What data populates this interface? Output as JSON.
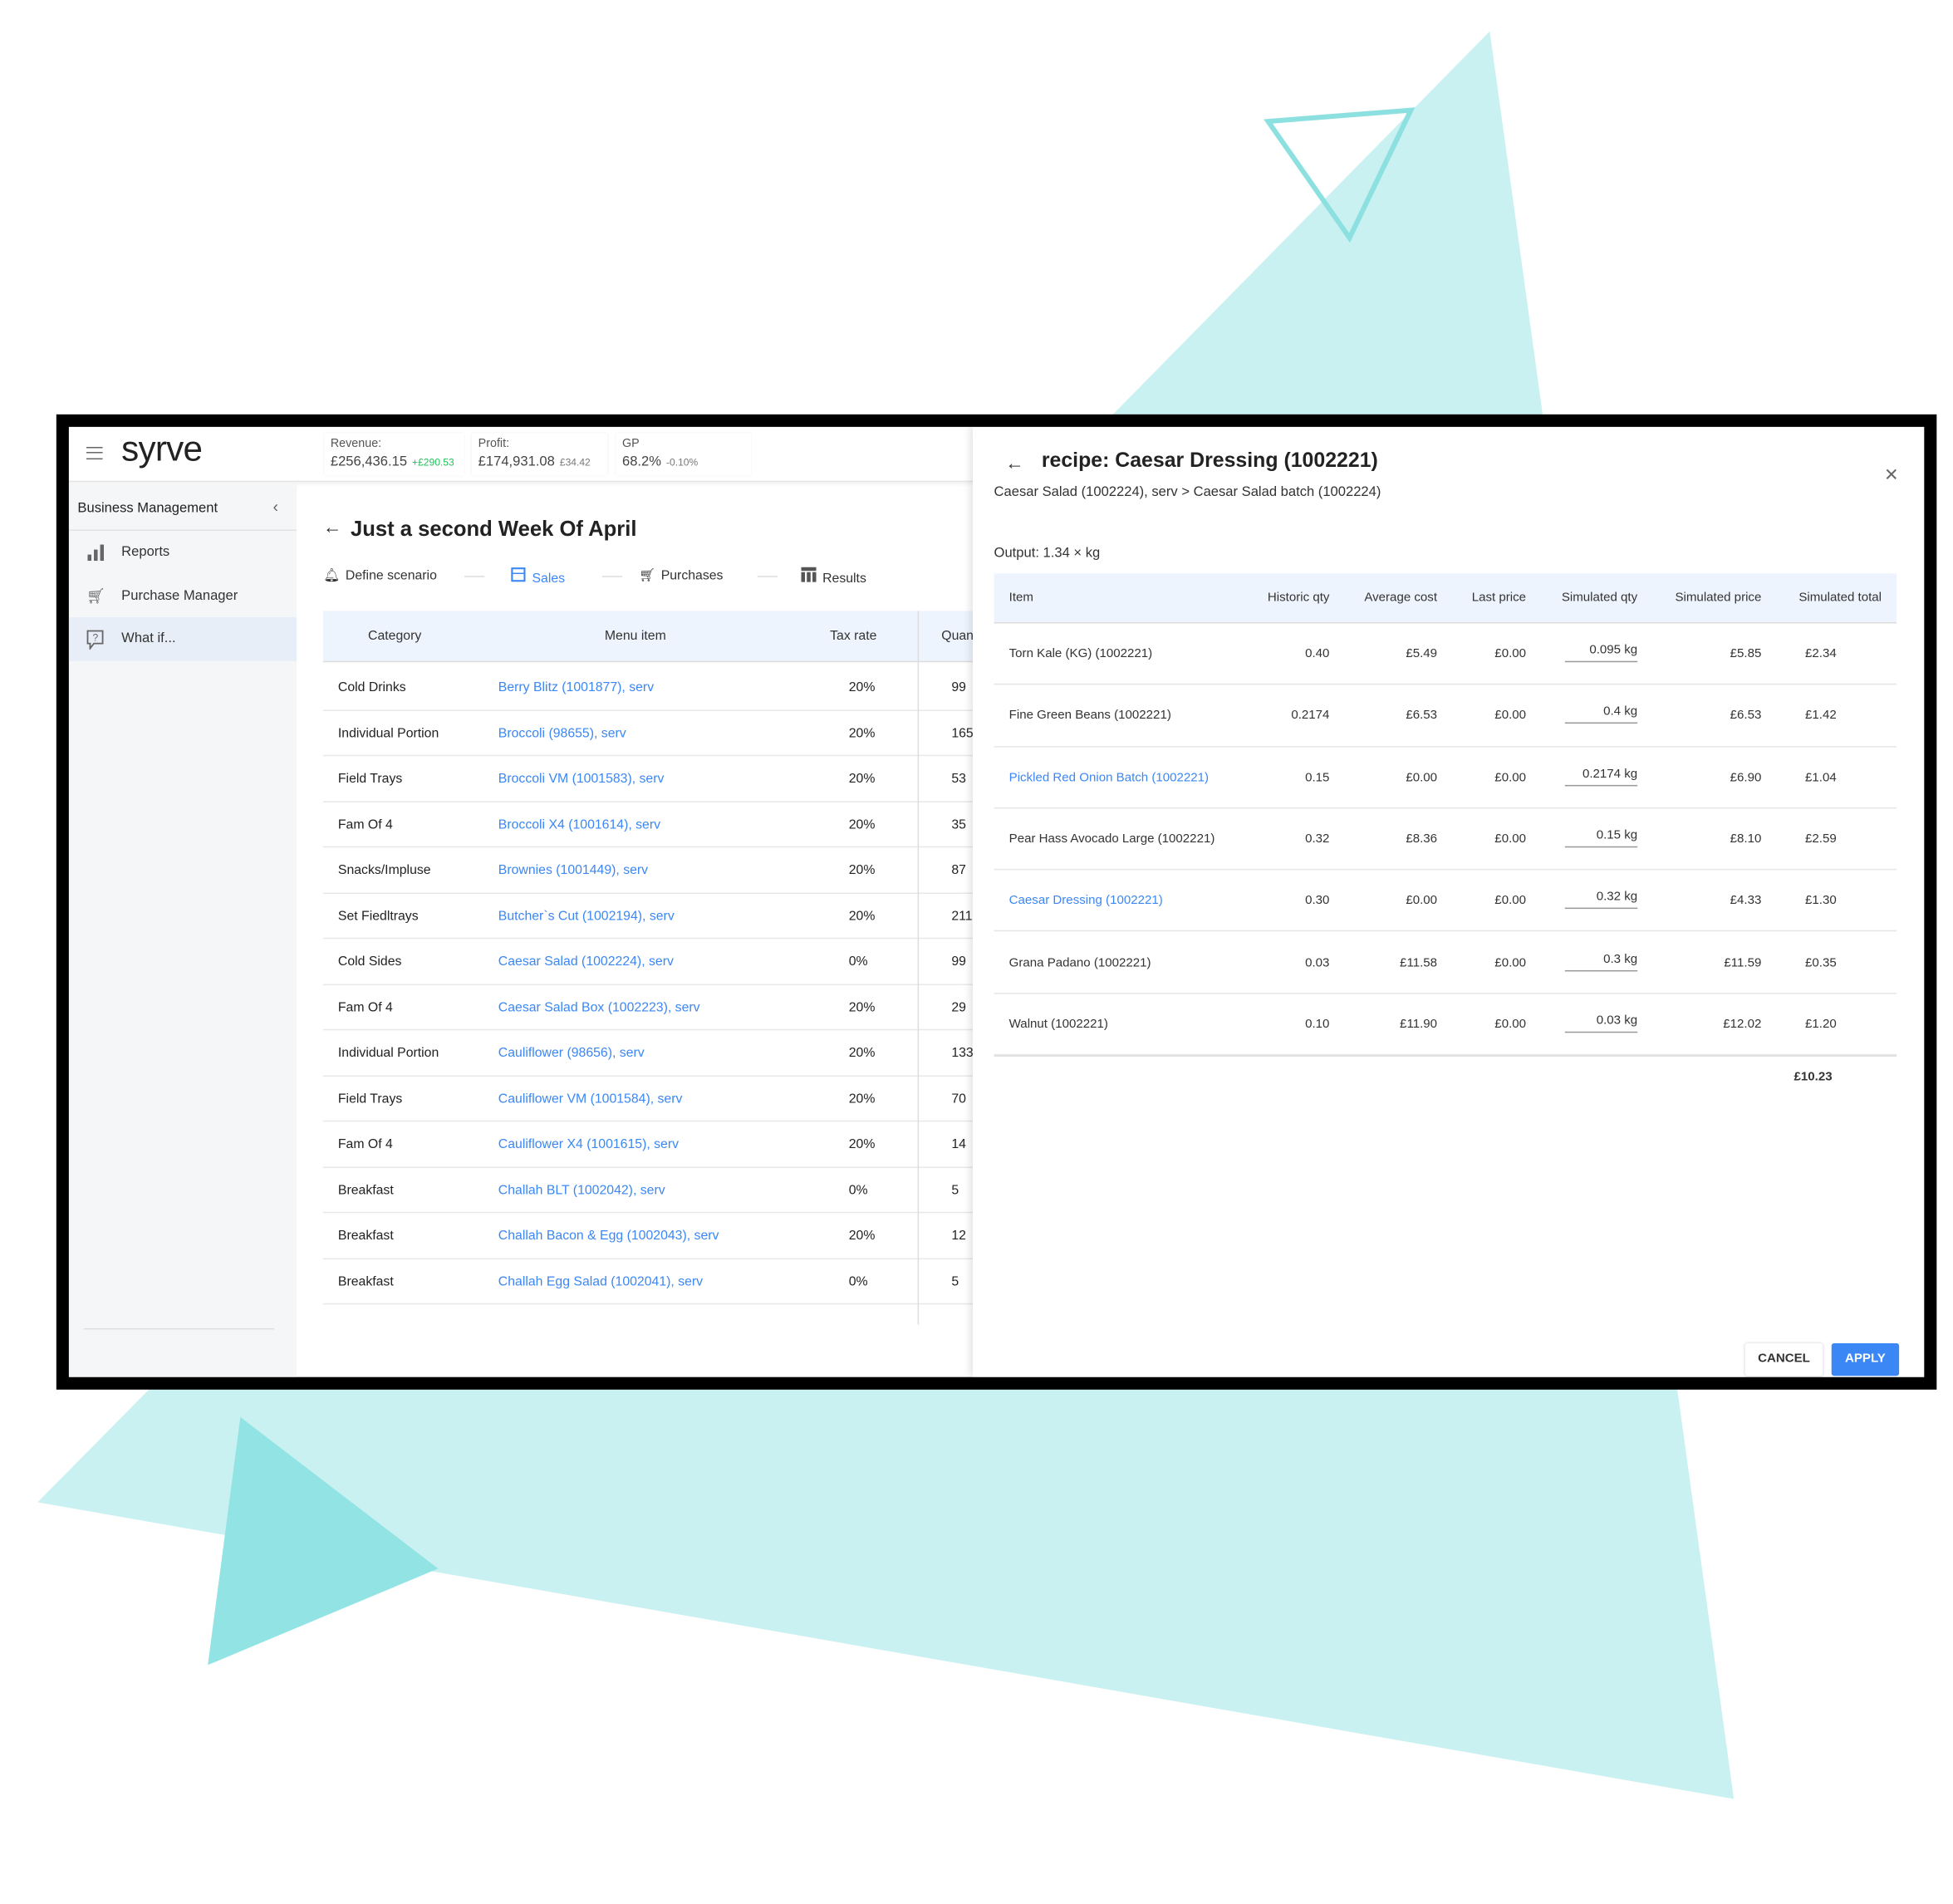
{
  "colors": {
    "accent": "#3b87f5",
    "positive": "#1fbf5a",
    "decor_light": "#c9f1f1",
    "decor_dark": "#92e3e3"
  },
  "header": {
    "logo": "syrve",
    "kpis": [
      {
        "label": "Revenue:",
        "value": "£256,436.15",
        "delta": "+£290.53"
      },
      {
        "label": "Profit:",
        "value": "£174,931.08",
        "delta": "£34.42"
      },
      {
        "label": "GP",
        "value": "68.2%",
        "delta": "-0.10%"
      }
    ]
  },
  "sidebar": {
    "section": "Business Management",
    "items": [
      {
        "label": "Reports",
        "icon": "bar-chart-icon"
      },
      {
        "label": "Purchase Manager",
        "icon": "cart-icon"
      },
      {
        "label": "What if...",
        "icon": "question-bubble-icon",
        "active": true
      }
    ]
  },
  "main": {
    "title": "Just a second Week Of April",
    "steps": [
      {
        "label": "Define scenario",
        "icon": "bell-icon"
      },
      {
        "label": "Sales",
        "icon": "store-icon",
        "active": true
      },
      {
        "label": "Purchases",
        "icon": "cart-icon"
      },
      {
        "label": "Results",
        "icon": "columns-icon"
      }
    ],
    "table": {
      "columns": [
        "Category",
        "Menu item",
        "Tax rate",
        "Quan"
      ],
      "rows": [
        [
          "Cold Drinks",
          "Berry Blitz (1001877), serv",
          "20%",
          "99"
        ],
        [
          "Individual Portion",
          "Broccoli (98655), serv",
          "20%",
          "165"
        ],
        [
          "Field Trays",
          "Broccoli VM (1001583), serv",
          "20%",
          "53"
        ],
        [
          "Fam Of 4",
          "Broccoli X4 (1001614), serv",
          "20%",
          "35"
        ],
        [
          "Snacks/Impluse",
          "Brownies (1001449), serv",
          "20%",
          "87"
        ],
        [
          "Set Fiedltrays",
          "Butcher`s Cut (1002194), serv",
          "20%",
          "211"
        ],
        [
          "Cold Sides",
          "Caesar Salad (1002224), serv",
          "0%",
          "99"
        ],
        [
          "Fam Of 4",
          "Caesar Salad Box (1002223), serv",
          "20%",
          "29"
        ],
        [
          "Individual Portion",
          "Cauliflower (98656), serv",
          "20%",
          "133"
        ],
        [
          "Field Trays",
          "Cauliflower VM (1001584), serv",
          "20%",
          "70"
        ],
        [
          "Fam Of 4",
          "Cauliflower X4 (1001615), serv",
          "20%",
          "14"
        ],
        [
          "Breakfast",
          "Challah BLT (1002042), serv",
          "0%",
          "5"
        ],
        [
          "Breakfast",
          "Challah Bacon & Egg (1002043), serv",
          "20%",
          "12"
        ],
        [
          "Breakfast",
          "Challah Egg Salad (1002041), serv",
          "0%",
          "5"
        ]
      ]
    }
  },
  "panel": {
    "title": "recipe: Caesar Dressing (1002221)",
    "breadcrumb": "Caesar Salad (1002224), serv > Caesar Salad batch (1002224)",
    "output": "Output: 1.34 × kg",
    "columns": [
      "Item",
      "Historic qty",
      "Average cost",
      "Last price",
      "Simulated qty",
      "Simulated price",
      "Simulated total"
    ],
    "rows": [
      {
        "item": "Torn Kale (KG) (1002221)",
        "link": false,
        "historic": "0.40",
        "avg": "£5.49",
        "last": "£0.00",
        "sim_qty": "0.095 kg",
        "sim_price": "£5.85",
        "sim_total": "£2.34"
      },
      {
        "item": "Fine Green Beans (1002221)",
        "link": false,
        "historic": "0.2174",
        "avg": "£6.53",
        "last": "£0.00",
        "sim_qty": "0.4 kg",
        "sim_price": "£6.53",
        "sim_total": "£1.42"
      },
      {
        "item": "Pickled Red Onion Batch (1002221)",
        "link": true,
        "historic": "0.15",
        "avg": "£0.00",
        "last": "£0.00",
        "sim_qty": "0.2174 kg",
        "sim_price": "£6.90",
        "sim_total": "£1.04"
      },
      {
        "item": "Pear Hass Avocado Large (1002221)",
        "link": false,
        "historic": "0.32",
        "avg": "£8.36",
        "last": "£0.00",
        "sim_qty": "0.15 kg",
        "sim_price": "£8.10",
        "sim_total": "£2.59"
      },
      {
        "item": "Caesar Dressing (1002221)",
        "link": true,
        "historic": "0.30",
        "avg": "£0.00",
        "last": "£0.00",
        "sim_qty": "0.32 kg",
        "sim_price": "£4.33",
        "sim_total": "£1.30"
      },
      {
        "item": "Grana Padano (1002221)",
        "link": false,
        "historic": "0.03",
        "avg": "£11.58",
        "last": "£0.00",
        "sim_qty": "0.3 kg",
        "sim_price": "£11.59",
        "sim_total": "£0.35"
      },
      {
        "item": "Walnut (1002221)",
        "link": false,
        "historic": "0.10",
        "avg": "£11.90",
        "last": "£0.00",
        "sim_qty": "0.03 kg",
        "sim_price": "£12.02",
        "sim_total": "£1.20"
      }
    ],
    "total": "£10.23",
    "cancel": "CANCEL",
    "apply": "APPLY"
  }
}
